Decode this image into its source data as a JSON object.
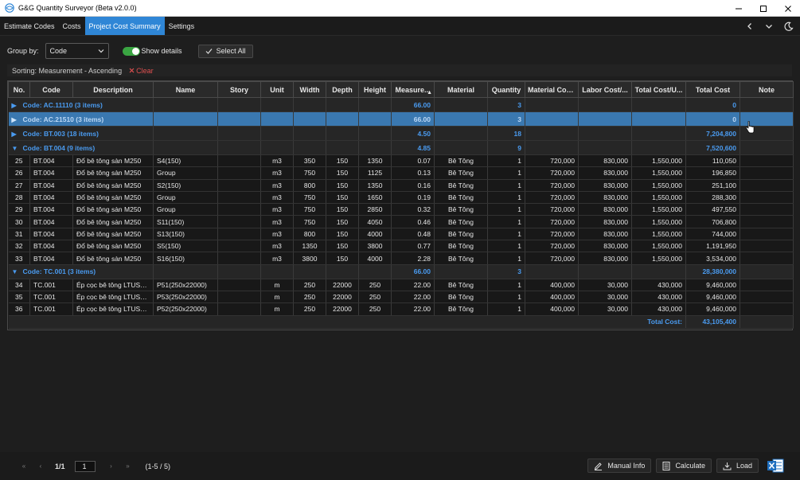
{
  "window": {
    "title": "G&G Quantity Surveyor (Beta v2.0.0)"
  },
  "tabs": [
    {
      "label": "Estimate Codes"
    },
    {
      "label": "Costs"
    },
    {
      "label": "Project Cost Summary"
    },
    {
      "label": "Settings"
    }
  ],
  "toolbar": {
    "group_by_label": "Group by:",
    "group_by_value": "Code",
    "show_details_label": "Show details",
    "show_details_on": true,
    "select_all_label": "Select All"
  },
  "sortbar": {
    "text": "Sorting: Measurement - Ascending",
    "clear_label": "Clear"
  },
  "columns": [
    "No.",
    "Code",
    "Description",
    "Name",
    "Story",
    "Unit",
    "Width",
    "Depth",
    "Height",
    "Measure...",
    "Material",
    "Quantity",
    "Material Cos...",
    "Labor Cost/...",
    "Total Cost/U...",
    "Total Cost",
    "Note"
  ],
  "groups": [
    {
      "label": "Code: AC.11110 (3 items)",
      "measure": "66.00",
      "quantity": "3",
      "total": "0",
      "expanded": false,
      "selected": false,
      "rows": []
    },
    {
      "label": "Code: AC.21510 (3 items)",
      "measure": "66.00",
      "quantity": "3",
      "total": "0",
      "expanded": false,
      "selected": true,
      "rows": []
    },
    {
      "label": "Code: BT.003 (18 items)",
      "measure": "4.50",
      "quantity": "18",
      "total": "7,204,800",
      "expanded": false,
      "selected": false,
      "rows": []
    },
    {
      "label": "Code: BT.004 (9 items)",
      "measure": "4.85",
      "quantity": "9",
      "total": "7,520,600",
      "expanded": true,
      "selected": false,
      "rows": [
        {
          "no": "25",
          "code": "BT.004",
          "description": "Đổ bê tông sàn M250",
          "name": "S4(150)",
          "story": "",
          "unit": "m3",
          "width": "350",
          "depth": "150",
          "height": "1350",
          "measure": "0.07",
          "material": "Bê Tông",
          "quantity": "1",
          "material_cost": "720,000",
          "labor_cost": "830,000",
          "total_cost_unit": "1,550,000",
          "total_cost": "110,050",
          "note": ""
        },
        {
          "no": "26",
          "code": "BT.004",
          "description": "Đổ bê tông sàn M250",
          "name": "Group",
          "story": "",
          "unit": "m3",
          "width": "750",
          "depth": "150",
          "height": "1125",
          "measure": "0.13",
          "material": "Bê Tông",
          "quantity": "1",
          "material_cost": "720,000",
          "labor_cost": "830,000",
          "total_cost_unit": "1,550,000",
          "total_cost": "196,850",
          "note": ""
        },
        {
          "no": "27",
          "code": "BT.004",
          "description": "Đổ bê tông sàn M250",
          "name": "S2(150)",
          "story": "",
          "unit": "m3",
          "width": "800",
          "depth": "150",
          "height": "1350",
          "measure": "0.16",
          "material": "Bê Tông",
          "quantity": "1",
          "material_cost": "720,000",
          "labor_cost": "830,000",
          "total_cost_unit": "1,550,000",
          "total_cost": "251,100",
          "note": ""
        },
        {
          "no": "28",
          "code": "BT.004",
          "description": "Đổ bê tông sàn M250",
          "name": "Group",
          "story": "",
          "unit": "m3",
          "width": "750",
          "depth": "150",
          "height": "1650",
          "measure": "0.19",
          "material": "Bê Tông",
          "quantity": "1",
          "material_cost": "720,000",
          "labor_cost": "830,000",
          "total_cost_unit": "1,550,000",
          "total_cost": "288,300",
          "note": ""
        },
        {
          "no": "29",
          "code": "BT.004",
          "description": "Đổ bê tông sàn M250",
          "name": "Group",
          "story": "",
          "unit": "m3",
          "width": "750",
          "depth": "150",
          "height": "2850",
          "measure": "0.32",
          "material": "Bê Tông",
          "quantity": "1",
          "material_cost": "720,000",
          "labor_cost": "830,000",
          "total_cost_unit": "1,550,000",
          "total_cost": "497,550",
          "note": ""
        },
        {
          "no": "30",
          "code": "BT.004",
          "description": "Đổ bê tông sàn M250",
          "name": "S11(150)",
          "story": "",
          "unit": "m3",
          "width": "750",
          "depth": "150",
          "height": "4050",
          "measure": "0.46",
          "material": "Bê Tông",
          "quantity": "1",
          "material_cost": "720,000",
          "labor_cost": "830,000",
          "total_cost_unit": "1,550,000",
          "total_cost": "706,800",
          "note": ""
        },
        {
          "no": "31",
          "code": "BT.004",
          "description": "Đổ bê tông sàn M250",
          "name": "S13(150)",
          "story": "",
          "unit": "m3",
          "width": "800",
          "depth": "150",
          "height": "4000",
          "measure": "0.48",
          "material": "Bê Tông",
          "quantity": "1",
          "material_cost": "720,000",
          "labor_cost": "830,000",
          "total_cost_unit": "1,550,000",
          "total_cost": "744,000",
          "note": ""
        },
        {
          "no": "32",
          "code": "BT.004",
          "description": "Đổ bê tông sàn M250",
          "name": "S5(150)",
          "story": "",
          "unit": "m3",
          "width": "1350",
          "depth": "150",
          "height": "3800",
          "measure": "0.77",
          "material": "Bê Tông",
          "quantity": "1",
          "material_cost": "720,000",
          "labor_cost": "830,000",
          "total_cost_unit": "1,550,000",
          "total_cost": "1,191,950",
          "note": ""
        },
        {
          "no": "33",
          "code": "BT.004",
          "description": "Đổ bê tông sàn M250",
          "name": "S16(150)",
          "story": "",
          "unit": "m3",
          "width": "3800",
          "depth": "150",
          "height": "4000",
          "measure": "2.28",
          "material": "Bê Tông",
          "quantity": "1",
          "material_cost": "720,000",
          "labor_cost": "830,000",
          "total_cost_unit": "1,550,000",
          "total_cost": "3,534,000",
          "note": ""
        }
      ]
    },
    {
      "label": "Code: TC.001 (3 items)",
      "measure": "66.00",
      "quantity": "3",
      "total": "28,380,000",
      "expanded": true,
      "selected": false,
      "rows": [
        {
          "no": "34",
          "code": "TC.001",
          "description": "Ép cọc bê tông LTUST 250x250",
          "name": "P51(250x22000)",
          "story": "",
          "unit": "m",
          "width": "250",
          "depth": "22000",
          "height": "250",
          "measure": "22.00",
          "material": "Bê Tông",
          "quantity": "1",
          "material_cost": "400,000",
          "labor_cost": "30,000",
          "total_cost_unit": "430,000",
          "total_cost": "9,460,000",
          "note": ""
        },
        {
          "no": "35",
          "code": "TC.001",
          "description": "Ép cọc bê tông LTUST 250x250",
          "name": "P53(250x22000)",
          "story": "",
          "unit": "m",
          "width": "250",
          "depth": "22000",
          "height": "250",
          "measure": "22.00",
          "material": "Bê Tông",
          "quantity": "1",
          "material_cost": "400,000",
          "labor_cost": "30,000",
          "total_cost_unit": "430,000",
          "total_cost": "9,460,000",
          "note": ""
        },
        {
          "no": "36",
          "code": "TC.001",
          "description": "Ép cọc bê tông LTUST 250x250",
          "name": "P52(250x22000)",
          "story": "",
          "unit": "m",
          "width": "250",
          "depth": "22000",
          "height": "250",
          "measure": "22.00",
          "material": "Bê Tông",
          "quantity": "1",
          "material_cost": "400,000",
          "labor_cost": "30,000",
          "total_cost_unit": "430,000",
          "total_cost": "9,460,000",
          "note": ""
        }
      ]
    }
  ],
  "footer_total": {
    "label": "Total Cost:",
    "value": "43,105,400"
  },
  "pager": {
    "page_info": "1/1",
    "page_input": "1",
    "range": "(1-5 / 5)"
  },
  "actions": {
    "manual_info": "Manual Info",
    "calculate": "Calculate",
    "load": "Load"
  },
  "colors": {
    "accent": "#2f86d6",
    "group_text": "#4a9bf0",
    "toggle_on": "#3aa542",
    "clear_red": "#e05050",
    "excel_green": "#1f6fbf"
  }
}
